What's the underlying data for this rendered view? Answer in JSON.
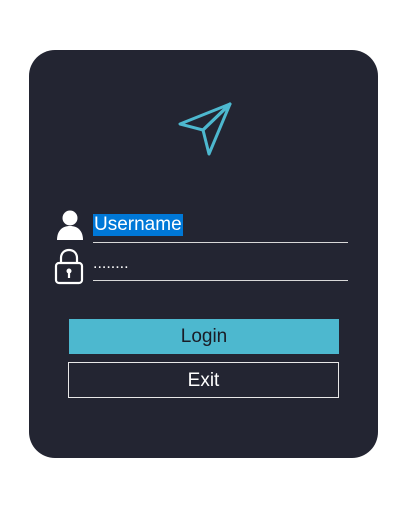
{
  "login": {
    "username_value": "Username",
    "password_value": "........",
    "login_label": "Login",
    "exit_label": "Exit"
  },
  "colors": {
    "card_background": "#232532",
    "accent": "#4db8cf",
    "selection": "#0078d7",
    "text": "#ffffff"
  },
  "icons": {
    "logo": "paper-plane-icon",
    "username": "user-icon",
    "password": "lock-icon"
  }
}
